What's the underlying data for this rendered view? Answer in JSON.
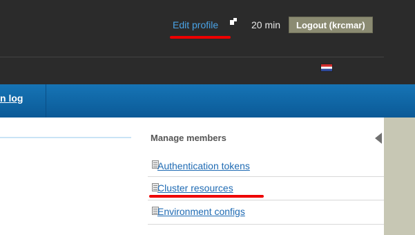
{
  "header": {
    "edit_profile": "Edit profile",
    "time_remaining": "20 min",
    "logout": "Logout (krcmar)"
  },
  "nav": {
    "item_partial": "n log"
  },
  "manage": {
    "title": "Manage members",
    "links": [
      "Authentication tokens",
      "Cluster resources",
      "Environment configs"
    ]
  },
  "colors": {
    "header_bg": "#2b2b2b",
    "nav_bg": "#0f67a8",
    "link": "#1e6ab3",
    "highlight": "#ee0000",
    "panel": "#c7c7b4"
  }
}
